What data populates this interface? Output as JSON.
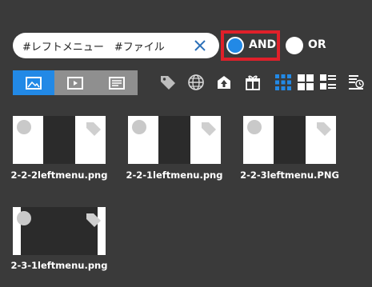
{
  "search": {
    "query": "#レフトメニュー　#ファイル",
    "clear_icon": "close-icon"
  },
  "match_mode": {
    "and_label": "AND",
    "or_label": "OR",
    "selected": "AND",
    "highlight_color": "#e0202a",
    "accent": "#2289e6"
  },
  "view_tabs": [
    {
      "name": "image-icon",
      "active": true
    },
    {
      "name": "video-icon",
      "active": false
    },
    {
      "name": "document-icon",
      "active": false
    }
  ],
  "toolbar_icons": [
    "tag-icon",
    "globe-icon",
    "upload-icon",
    "gift-icon",
    "grid-small-icon",
    "grid-large-icon",
    "list-icon",
    "sort-time-icon"
  ],
  "files": [
    {
      "label": "2-2-2leftmenu.png"
    },
    {
      "label": "2-2-1leftmenu.png"
    },
    {
      "label": "2-2-3leftmenu.PNG"
    },
    {
      "label": "2-3-1leftmenu.png"
    }
  ]
}
